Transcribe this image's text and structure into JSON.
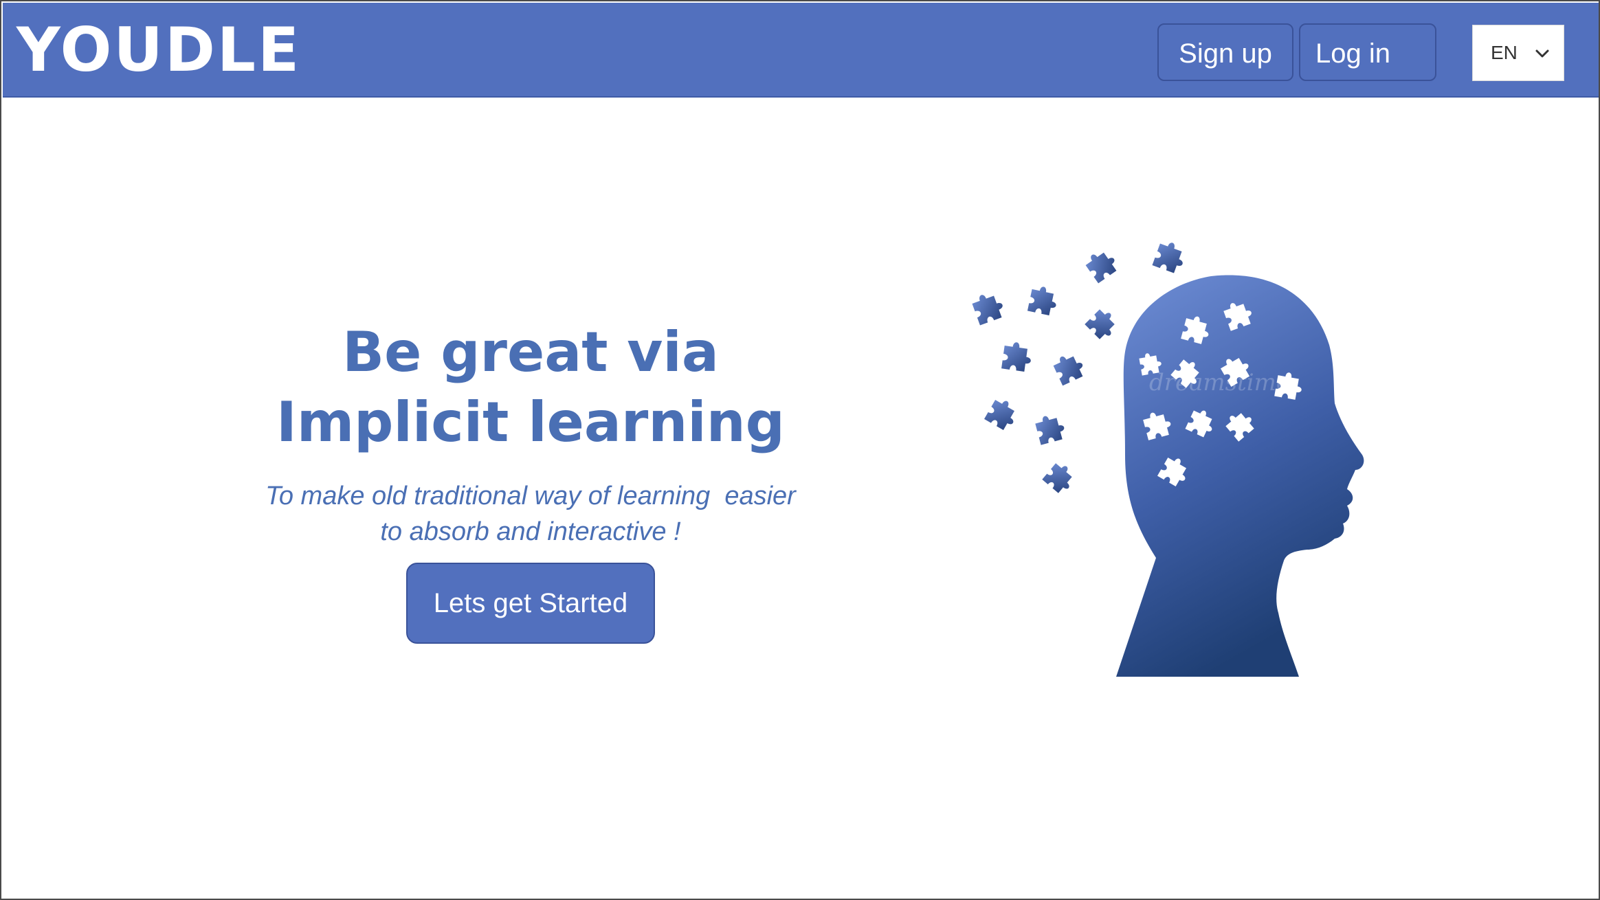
{
  "header": {
    "logo": "YOUDLE",
    "signup_label": "Sign up",
    "login_label": "Log in",
    "language": "EN"
  },
  "hero": {
    "title_line1": "Be great via",
    "title_line2": "Implicit learning",
    "subtitle_line1": "To make old traditional way of learning  easier",
    "subtitle_line2": "to absorb and interactive !",
    "cta_label": "Lets get Started",
    "illustration_watermark": "dreamstime"
  },
  "colors": {
    "brand": "#5270be",
    "text_accent": "#4a6fb4",
    "head_top": "#6f8ed6",
    "head_bottom": "#1f3f74"
  }
}
